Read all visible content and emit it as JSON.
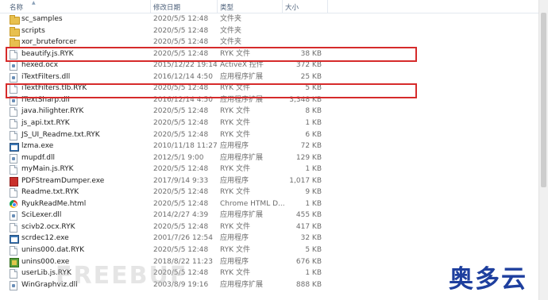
{
  "header": {
    "name": "名称",
    "date": "修改日期",
    "type": "类型",
    "size": "大小"
  },
  "rows": [
    {
      "name": "sc_samples",
      "date": "2020/5/5 12:48",
      "type": "文件夹",
      "size": "",
      "icon": "folder-icon"
    },
    {
      "name": "scripts",
      "date": "2020/5/5 12:48",
      "type": "文件夹",
      "size": "",
      "icon": "folder-icon"
    },
    {
      "name": "xor_bruteforcer",
      "date": "2020/5/5 12:48",
      "type": "文件夹",
      "size": "",
      "icon": "folder-icon"
    },
    {
      "name": "beautify.js.RYK",
      "date": "2020/5/5 12:48",
      "type": "RYK 文件",
      "size": "38 KB",
      "icon": "file-icon"
    },
    {
      "name": "hexed.ocx",
      "date": "2015/12/22 19:14",
      "type": "ActiveX 控件",
      "size": "372 KB",
      "icon": "dll-icon"
    },
    {
      "name": "iTextFilters.dll",
      "date": "2016/12/14 4:50",
      "type": "应用程序扩展",
      "size": "25 KB",
      "icon": "dll-icon"
    },
    {
      "name": "iTextFilters.tlb.RYK",
      "date": "2020/5/5 12:48",
      "type": "RYK 文件",
      "size": "5 KB",
      "icon": "file-icon"
    },
    {
      "name": "iTextSharp.dll",
      "date": "2016/12/14 4:50",
      "type": "应用程序扩展",
      "size": "3,348 KB",
      "icon": "dll-icon"
    },
    {
      "name": "java.hilighter.RYK",
      "date": "2020/5/5 12:48",
      "type": "RYK 文件",
      "size": "8 KB",
      "icon": "file-icon"
    },
    {
      "name": "js_api.txt.RYK",
      "date": "2020/5/5 12:48",
      "type": "RYK 文件",
      "size": "1 KB",
      "icon": "file-icon"
    },
    {
      "name": "JS_UI_Readme.txt.RYK",
      "date": "2020/5/5 12:48",
      "type": "RYK 文件",
      "size": "6 KB",
      "icon": "file-icon"
    },
    {
      "name": "lzma.exe",
      "date": "2010/11/18 11:27",
      "type": "应用程序",
      "size": "72 KB",
      "icon": "exe-icon"
    },
    {
      "name": "mupdf.dll",
      "date": "2012/5/1 9:00",
      "type": "应用程序扩展",
      "size": "129 KB",
      "icon": "dll-icon"
    },
    {
      "name": "myMain.js.RYK",
      "date": "2020/5/5 12:48",
      "type": "RYK 文件",
      "size": "1 KB",
      "icon": "file-icon"
    },
    {
      "name": "PDFStreamDumper.exe",
      "date": "2017/9/14 9:33",
      "type": "应用程序",
      "size": "1,017 KB",
      "icon": "pdf-icon"
    },
    {
      "name": "Readme.txt.RYK",
      "date": "2020/5/5 12:48",
      "type": "RYK 文件",
      "size": "9 KB",
      "icon": "file-icon"
    },
    {
      "name": "RyukReadMe.html",
      "date": "2020/5/5 12:48",
      "type": "Chrome HTML D...",
      "size": "1 KB",
      "icon": "chrome-icon"
    },
    {
      "name": "SciLexer.dll",
      "date": "2014/2/27 4:39",
      "type": "应用程序扩展",
      "size": "455 KB",
      "icon": "dll-icon"
    },
    {
      "name": "scivb2.ocx.RYK",
      "date": "2020/5/5 12:48",
      "type": "RYK 文件",
      "size": "417 KB",
      "icon": "file-icon"
    },
    {
      "name": "scrdec12.exe",
      "date": "2001/7/26 12:54",
      "type": "应用程序",
      "size": "32 KB",
      "icon": "exe-icon"
    },
    {
      "name": "unins000.dat.RYK",
      "date": "2020/5/5 12:48",
      "type": "RYK 文件",
      "size": "5 KB",
      "icon": "file-icon"
    },
    {
      "name": "unins000.exe",
      "date": "2018/8/22 11:23",
      "type": "应用程序",
      "size": "676 KB",
      "icon": "installer-icon"
    },
    {
      "name": "userLib.js.RYK",
      "date": "2020/5/5 12:48",
      "type": "RYK 文件",
      "size": "1 KB",
      "icon": "file-icon"
    },
    {
      "name": "WinGraphviz.dll",
      "date": "2003/8/9 19:16",
      "type": "应用程序扩展",
      "size": "888 KB",
      "icon": "dll-icon"
    }
  ],
  "highlight_color": "#d62b2b",
  "watermarks": {
    "freebuf": "FREEBUF",
    "brand": "奥多云"
  }
}
